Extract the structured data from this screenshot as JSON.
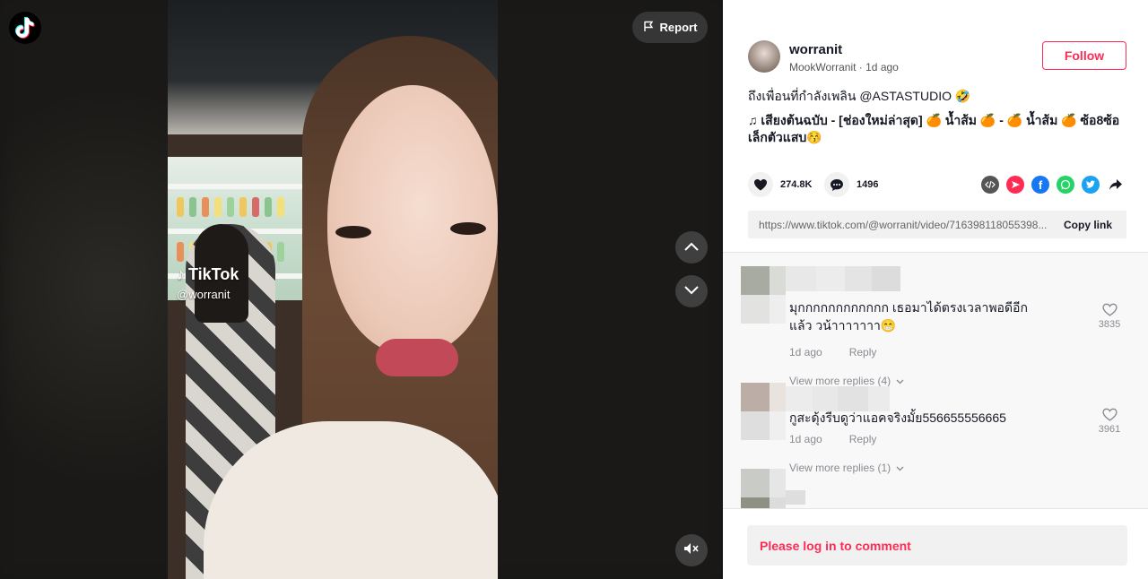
{
  "video": {
    "watermark_brand": "TikTok",
    "watermark_user": "@worranit",
    "report_label": "Report"
  },
  "author": {
    "username": "worranit",
    "subtitle": "MookWorranit · 1d ago",
    "follow_label": "Follow"
  },
  "post": {
    "caption": "ถึงเพื่อนที่กำลังเพลิน @ASTASTUDIO 🤣",
    "music": "เสียงต้นฉบับ - [ช่องใหม่ล่าสุด] 🍊 น้ำส้ม 🍊 - 🍊 น้ำส้ม 🍊 ซ้อ8ซ้อ เล็กตัวแสบ😚"
  },
  "stats": {
    "likes": "274.8K",
    "comments": "1496"
  },
  "share": {
    "icons": [
      "embed-icon",
      "send-icon",
      "facebook-icon",
      "whatsapp-icon",
      "twitter-icon",
      "share-arrow-icon"
    ],
    "colors": {
      "embed": "#555555",
      "send": "#fe2c55",
      "facebook": "#1877f2",
      "whatsapp": "#25d366",
      "twitter": "#1da1f2"
    }
  },
  "link": {
    "url": "https://www.tiktok.com/@worranit/video/716398118055398...",
    "copy_label": "Copy link"
  },
  "comments": [
    {
      "text": "มุกกกกกกกกกกกก เธอมาได้ตรงเวลาพอดีอีกแล้ว วน้าาาาาาา😁",
      "time": "1d ago",
      "reply_label": "Reply",
      "likes": "3835",
      "more_replies": "View more replies (4)"
    },
    {
      "text": "กูสะดุ้งรีบดูว่าแอคจริงมั้ย556655556665",
      "time": "1d ago",
      "reply_label": "Reply",
      "likes": "3961",
      "more_replies": "View more replies (1)"
    }
  ],
  "login_prompt": "Please log in to comment",
  "accent_color": "#fe2c55"
}
